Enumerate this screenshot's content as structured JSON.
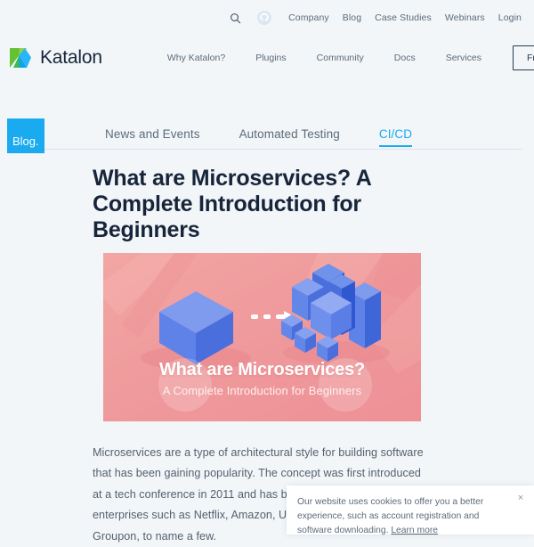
{
  "colors": {
    "page_bg": "#f2f6f9",
    "brand_blue": "#19aaf0",
    "heading": "#17243a",
    "body_text": "#55606e",
    "hero_pink": "#ef9a9c",
    "cube_blue": "#6b8ce8"
  },
  "utility_nav": {
    "search_icon": "search-icon",
    "github_icon": "github-icon",
    "items": [
      {
        "label": "Company"
      },
      {
        "label": "Blog"
      },
      {
        "label": "Case Studies"
      },
      {
        "label": "Webinars"
      },
      {
        "label": "Login"
      }
    ]
  },
  "main_nav": {
    "brand_name": "Katalon",
    "brand_icon": "katalon-logo-icon",
    "items": [
      {
        "label": "Why Katalon?"
      },
      {
        "label": "Plugins"
      },
      {
        "label": "Community"
      },
      {
        "label": "Docs"
      },
      {
        "label": "Services"
      }
    ],
    "cta_label": "Free Download"
  },
  "blog_bar": {
    "badge_label": "Blog.",
    "tabs": [
      {
        "label": "News and Events",
        "active": false
      },
      {
        "label": "Automated Testing",
        "active": false
      },
      {
        "label": "CI/CD",
        "active": true
      }
    ]
  },
  "article": {
    "title": "What are Microservices? A Complete Introduction for Beginners",
    "hero": {
      "title": "What are Microservices?",
      "subtitle": "A Complete Introduction for Beginners",
      "alt": "monolith-to-microservices-illustration"
    },
    "body": "Microservices are a type of architectural style for building software that has been gaining popularity. The concept was first introduced at a tech conference in 2011 and has been adopted by many Agile enterprises such as Netflix, Amazon, Uber, SoundCloud, and Groupon, to name a few."
  },
  "cookie_banner": {
    "text": "Our website uses cookies to offer you a better experience, such as account registration and software downloading. ",
    "link_label": "Learn more",
    "close_icon": "close-icon",
    "close_label": "×"
  }
}
